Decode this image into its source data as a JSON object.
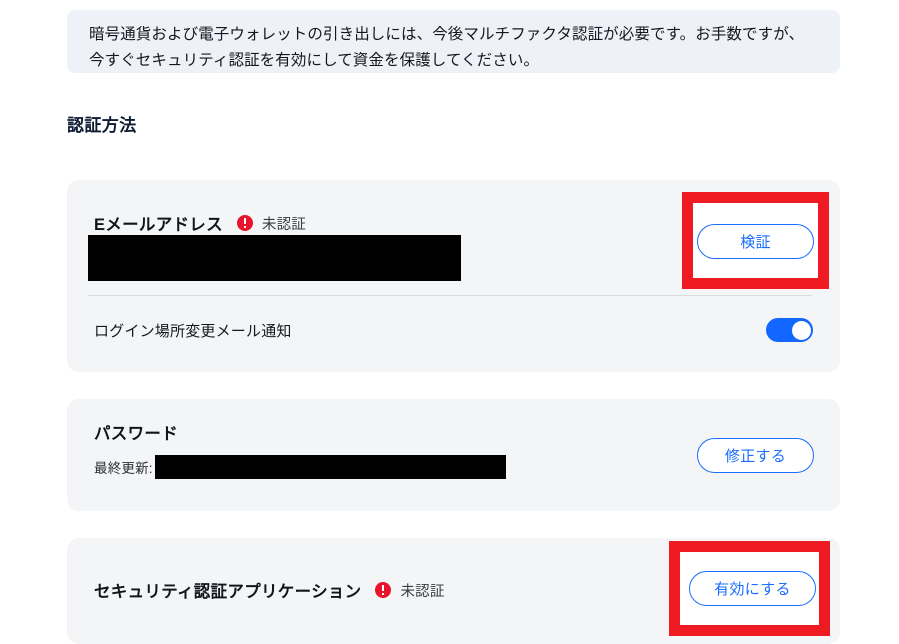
{
  "notice": {
    "text": "暗号通貨および電子ウォレットの引き出しには、今後マルチファクタ認証が必要です。お手数ですが、今すぐセキュリティ認証を有効にして資金を保護してください。"
  },
  "section": {
    "title": "認証方法"
  },
  "email_card": {
    "title": "Eメールアドレス",
    "status_icon": "alert-circle-icon",
    "status_label": "未認証",
    "email_value": "",
    "verify_button": "検証",
    "toggle_label": "ログイン場所変更メール通知",
    "toggle_state": "on"
  },
  "password_card": {
    "title": "パスワード",
    "last_updated_label": "最終更新:",
    "last_updated_value": "",
    "modify_button": "修正する"
  },
  "authapp_card": {
    "title": "セキュリティ認証アプリケーション",
    "status_icon": "alert-circle-icon",
    "status_label": "未認証",
    "enable_button": "有効にする"
  },
  "colors": {
    "accent_blue": "#1a6dff",
    "toggle_on": "#1366ff",
    "alert_red": "#e8142b",
    "annotation_red": "#f01a23",
    "card_bg": "#f4f5f7",
    "notice_bg": "#eef1f8",
    "heading": "#0d1b33"
  }
}
